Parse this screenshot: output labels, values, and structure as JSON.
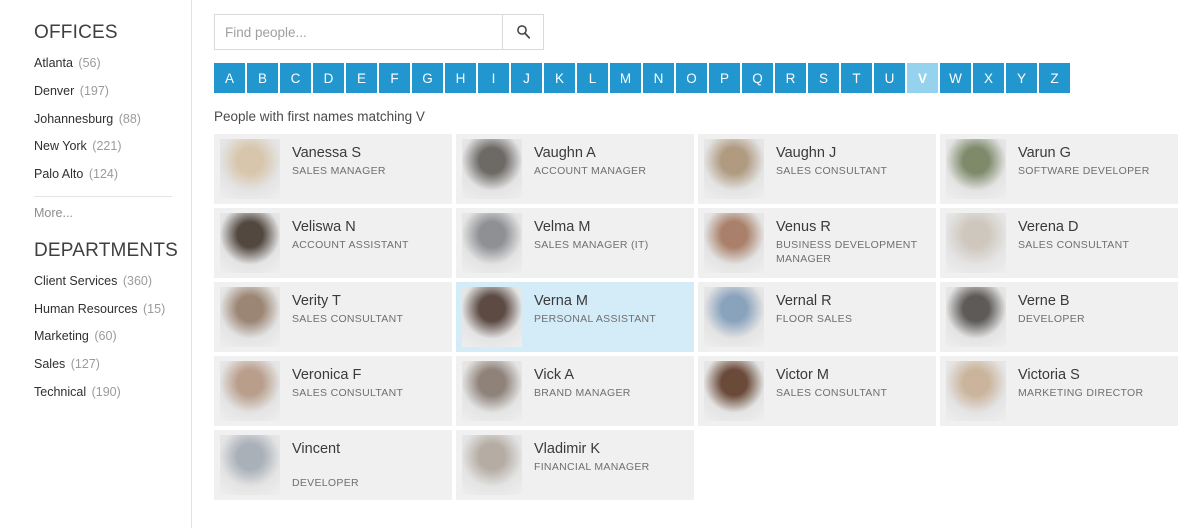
{
  "sidebar": {
    "offices": {
      "title": "OFFICES",
      "items": [
        {
          "label": "Atlanta",
          "count": "(56)"
        },
        {
          "label": "Denver",
          "count": "(197)"
        },
        {
          "label": "Johannesburg",
          "count": "(88)"
        },
        {
          "label": "New York",
          "count": "(221)"
        },
        {
          "label": "Palo Alto",
          "count": "(124)"
        }
      ],
      "more_label": "More..."
    },
    "departments": {
      "title": "DEPARTMENTS",
      "items": [
        {
          "label": "Client Services",
          "count": "(360)"
        },
        {
          "label": "Human Resources",
          "count": "(15)"
        },
        {
          "label": "Marketing",
          "count": "(60)"
        },
        {
          "label": "Sales",
          "count": "(127)"
        },
        {
          "label": "Technical",
          "count": "(190)"
        }
      ]
    }
  },
  "search": {
    "placeholder": "Find people...",
    "value": "",
    "button_icon": "search-icon"
  },
  "alphabet": {
    "letters": [
      "A",
      "B",
      "C",
      "D",
      "E",
      "F",
      "G",
      "H",
      "I",
      "J",
      "K",
      "L",
      "M",
      "N",
      "O",
      "P",
      "Q",
      "R",
      "S",
      "T",
      "U",
      "V",
      "W",
      "X",
      "Y",
      "Z"
    ],
    "active": "V"
  },
  "results": {
    "heading": "People with first names matching V",
    "people": [
      {
        "name": "Vanessa S",
        "title": "SALES MANAGER",
        "selected": false,
        "avatar": "#d8c6ac"
      },
      {
        "name": "Vaughn A",
        "title": "ACCOUNT MANAGER",
        "selected": false,
        "avatar": "#6d6a66"
      },
      {
        "name": "Vaughn J",
        "title": "SALES CONSULTANT",
        "selected": false,
        "avatar": "#b09a80"
      },
      {
        "name": "Varun G",
        "title": "SOFTWARE DEVELOPER",
        "selected": false,
        "avatar": "#7e8a6a"
      },
      {
        "name": "Veliswa N",
        "title": "ACCOUNT ASSISTANT",
        "selected": false,
        "avatar": "#52483f"
      },
      {
        "name": "Velma M",
        "title": "SALES MANAGER (IT)",
        "selected": false,
        "avatar": "#8e9094"
      },
      {
        "name": "Venus R",
        "title": "BUSINESS DEVELOPMENT MANAGER",
        "selected": false,
        "avatar": "#a98069"
      },
      {
        "name": "Verena D",
        "title": "SALES CONSULTANT",
        "selected": false,
        "avatar": "#cfc7bd"
      },
      {
        "name": "Verity T",
        "title": "SALES CONSULTANT",
        "selected": false,
        "avatar": "#9b8574"
      },
      {
        "name": "Verna M",
        "title": "PERSONAL ASSISTANT",
        "selected": true,
        "avatar": "#5c4a43"
      },
      {
        "name": "Vernal R",
        "title": "FLOOR SALES",
        "selected": false,
        "avatar": "#8aa3bd"
      },
      {
        "name": "Verne B",
        "title": "DEVELOPER",
        "selected": false,
        "avatar": "#5d5a57"
      },
      {
        "name": "Veronica F",
        "title": "SALES CONSULTANT",
        "selected": false,
        "avatar": "#b99e8c"
      },
      {
        "name": "Vick A",
        "title": "BRAND MANAGER",
        "selected": false,
        "avatar": "#8e8279"
      },
      {
        "name": "Victor M",
        "title": "SALES CONSULTANT",
        "selected": false,
        "avatar": "#6a4a38"
      },
      {
        "name": "Victoria S",
        "title": "MARKETING DIRECTOR",
        "selected": false,
        "avatar": "#cbb49c"
      },
      {
        "name": "Vincent",
        "title": "DEVELOPER",
        "selected": false,
        "avatar": "#a9b0b8",
        "title_gap": true
      },
      {
        "name": "Vladimir K",
        "title": "FINANCIAL MANAGER",
        "selected": false,
        "avatar": "#b5aca3"
      }
    ]
  },
  "colors": {
    "accent_blue": "#2196cf",
    "active_tile": "#94d2ee",
    "card_bg": "#f0f0f0",
    "selected_card_bg": "#d3ecf8"
  }
}
